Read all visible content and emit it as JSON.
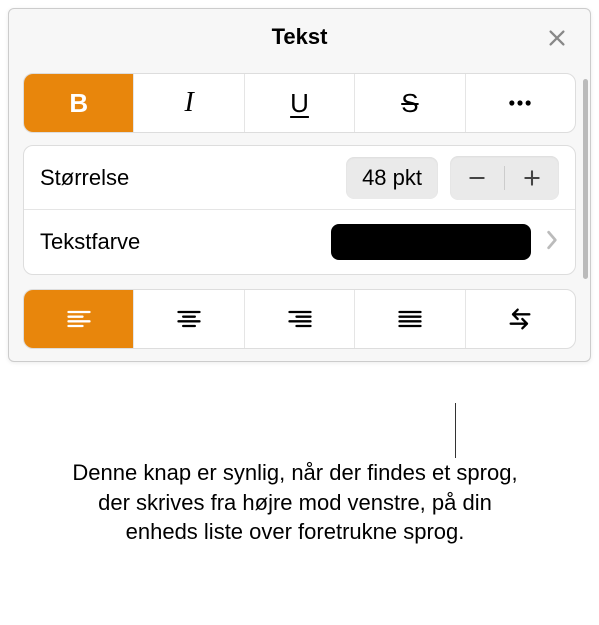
{
  "header": {
    "title": "Tekst"
  },
  "format": {
    "bold_label": "B",
    "italic_label": "I",
    "underline_label": "U",
    "strike_label": "S"
  },
  "size": {
    "label": "Størrelse",
    "value": "48 pkt"
  },
  "color": {
    "label": "Tekstfarve",
    "value": "#000000"
  },
  "callout": {
    "text": "Denne knap er synlig, når der findes et sprog, der skrives fra højre mod venstre, på din enheds liste over foretrukne sprog."
  }
}
